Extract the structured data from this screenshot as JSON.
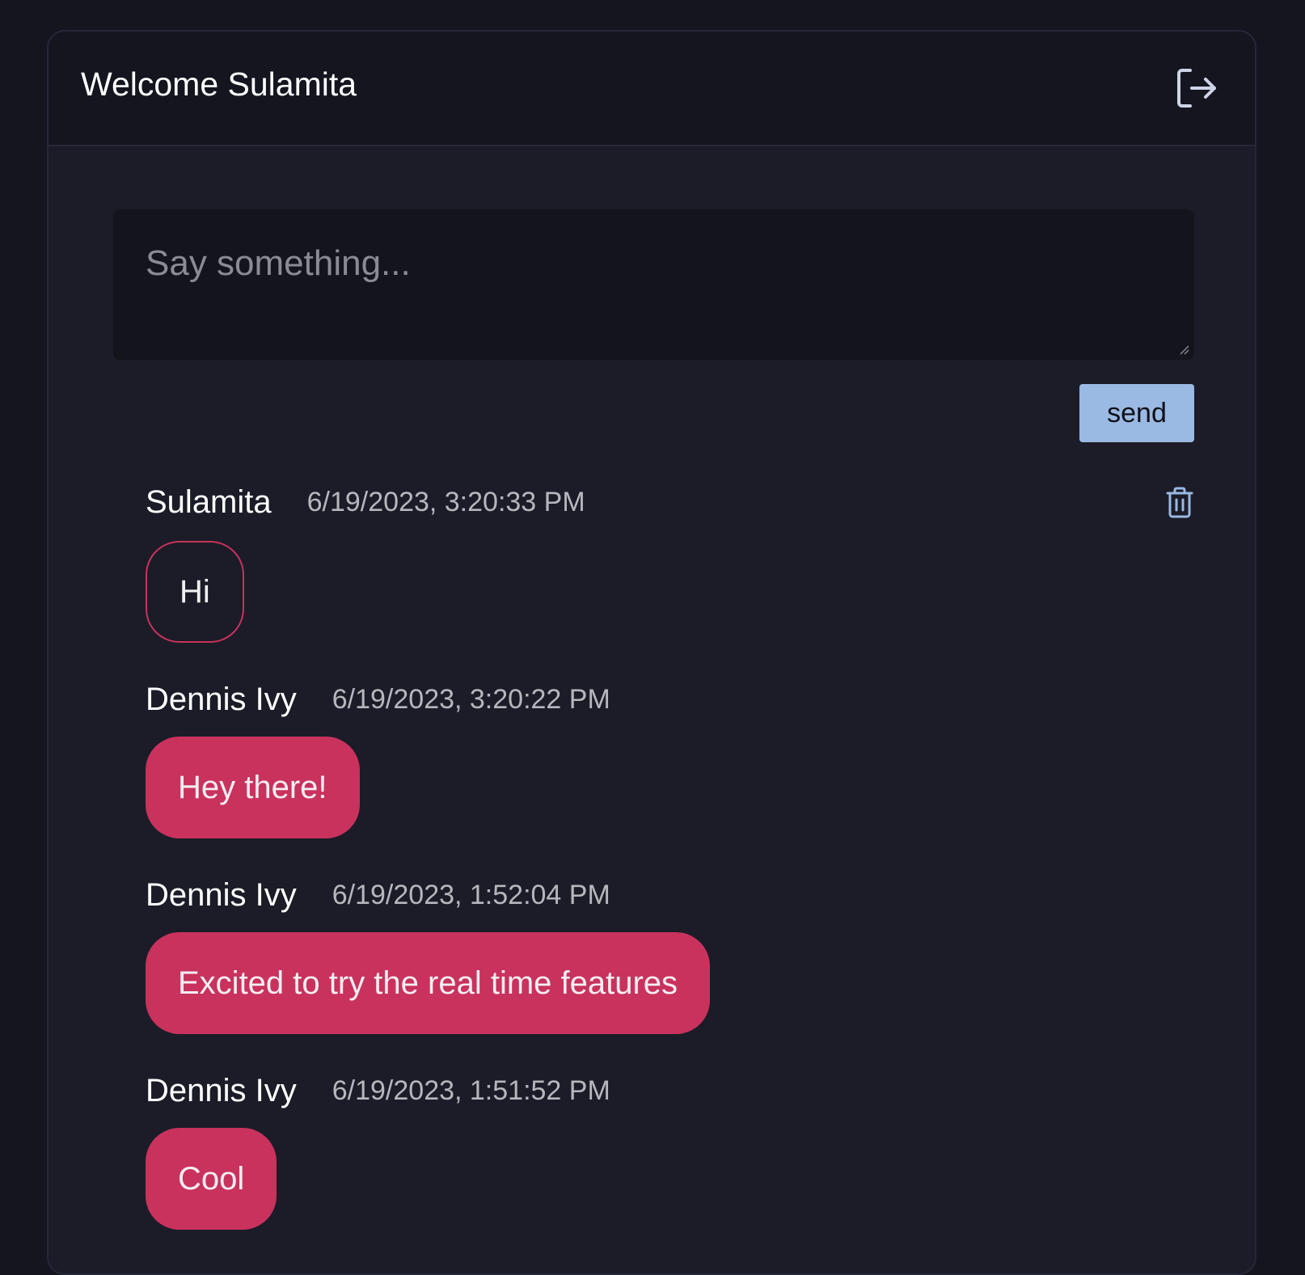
{
  "header": {
    "welcome_text": "Welcome Sulamita",
    "logout_icon": "logout-icon"
  },
  "composer": {
    "placeholder": "Say something...",
    "value": "",
    "send_label": "send"
  },
  "colors": {
    "page_background": "#14151f",
    "panel_background": "#1b1c27",
    "accent": "#c9325d",
    "send_button": "#9ab9e3",
    "delete_icon": "#9ab9e3"
  },
  "messages": [
    {
      "author": "Sulamita",
      "timestamp": "6/19/2023, 3:20:33 PM",
      "body": "Hi",
      "own": true,
      "delete_icon": "trash-icon"
    },
    {
      "author": "Dennis Ivy",
      "timestamp": "6/19/2023, 3:20:22 PM",
      "body": "Hey there!",
      "own": false
    },
    {
      "author": "Dennis Ivy",
      "timestamp": "6/19/2023, 1:52:04 PM",
      "body": "Excited to try the real time features",
      "own": false
    },
    {
      "author": "Dennis Ivy",
      "timestamp": "6/19/2023, 1:51:52 PM",
      "body": "Cool",
      "own": false
    }
  ]
}
